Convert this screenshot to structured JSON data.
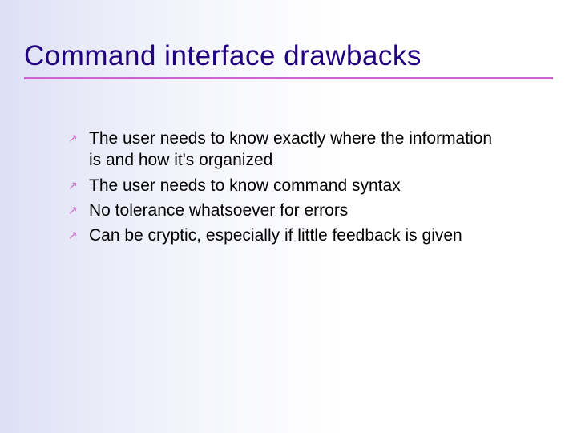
{
  "slide": {
    "title": "Command interface drawbacks",
    "bullets": [
      "The user needs to know exactly where the information is and how it's organized",
      "The user needs to know command syntax",
      "No tolerance whatsoever for errors",
      "Can be cryptic, especially if little feedback is given"
    ]
  }
}
